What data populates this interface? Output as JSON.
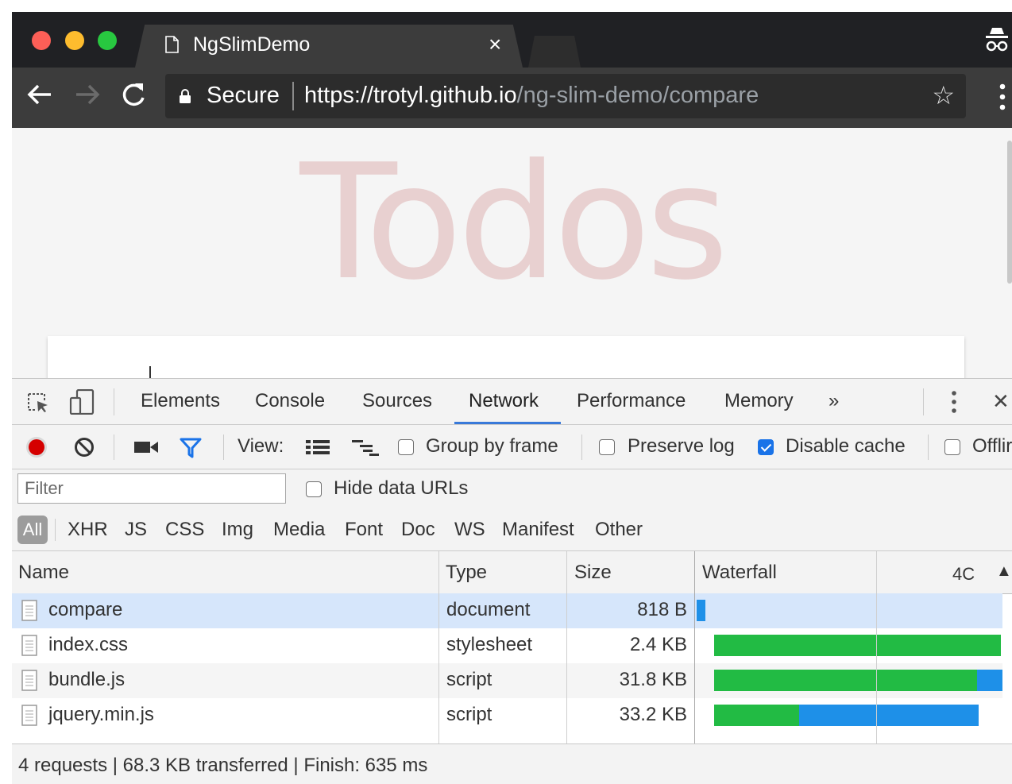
{
  "browser": {
    "tab_title": "NgSlimDemo",
    "tab_close": "×",
    "secure_label": "Secure",
    "url_host": "https://trotyl.github.io",
    "url_path": "/ng-slim-demo/compare",
    "bookmark_icon": "☆"
  },
  "page": {
    "heading": "Todos",
    "heading_color": "#af2f2f"
  },
  "devtools": {
    "tabs": [
      "Elements",
      "Console",
      "Sources",
      "Network",
      "Performance",
      "Memory",
      "»"
    ],
    "active_tab": "Network",
    "close_icon": "✕",
    "toolbar": {
      "view_label": "View:",
      "group_by_frame": {
        "label": "Group by frame",
        "checked": false
      },
      "preserve_log": {
        "label": "Preserve log",
        "checked": false
      },
      "disable_cache": {
        "label": "Disable cache",
        "checked": true
      },
      "offline": {
        "label": "Offlir",
        "checked": false
      }
    },
    "filter": {
      "placeholder": "Filter",
      "hide_data_urls": {
        "label": "Hide data URLs",
        "checked": false
      }
    },
    "types": {
      "selected": "All",
      "items": [
        "XHR",
        "JS",
        "CSS",
        "Img",
        "Media",
        "Font",
        "Doc",
        "WS",
        "Manifest",
        "Other"
      ]
    },
    "columns": {
      "name": "Name",
      "type": "Type",
      "size": "Size",
      "waterfall": "Waterfall",
      "waterfall_tick": "4C",
      "sort_icon": "▲"
    },
    "requests": [
      {
        "name": "compare",
        "type": "document",
        "size": "818 B",
        "selected": true
      },
      {
        "name": "index.css",
        "type": "stylesheet",
        "size": "2.4 KB",
        "selected": false
      },
      {
        "name": "bundle.js",
        "type": "script",
        "size": "31.8 KB",
        "selected": false
      },
      {
        "name": "jquery.min.js",
        "type": "script",
        "size": "33.2 KB",
        "selected": false
      }
    ],
    "timing_colors": {
      "waiting": "#22bb44",
      "download": "#1e90e8"
    },
    "status_bar": "4 requests | 68.3 KB transferred | Finish: 635 ms"
  }
}
